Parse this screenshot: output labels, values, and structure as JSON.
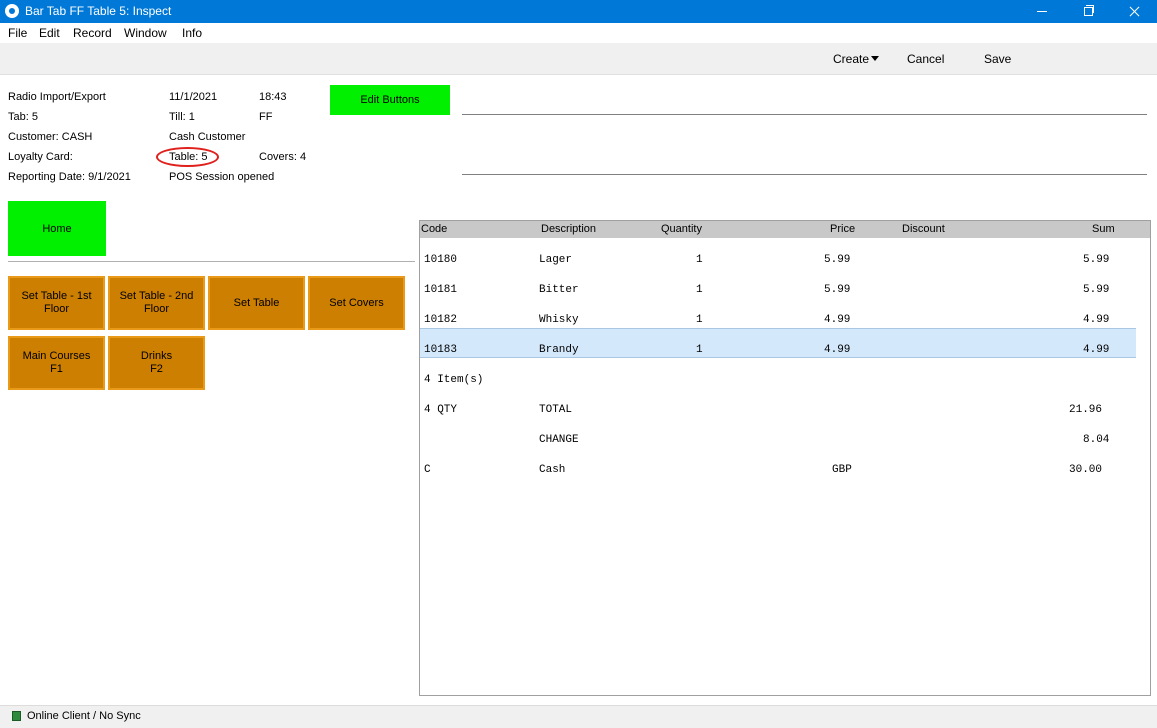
{
  "window": {
    "title": "Bar Tab FF Table 5: Inspect"
  },
  "menu": [
    "File",
    "Edit",
    "Record",
    "Window",
    "Info"
  ],
  "toolbar": {
    "create_label": "Create",
    "cancel_label": "Cancel",
    "save_label": "Save"
  },
  "info": {
    "radio_import_export": "Radio Import/Export",
    "date": "11/1/2021",
    "time": "18:43",
    "tab": "Tab: 5",
    "till": "Till: 1",
    "ff": "FF",
    "customer": "Customer: CASH",
    "customer_name": "Cash Customer",
    "loyalty_card": "Loyalty Card:",
    "table": "Table: 5",
    "covers": "Covers: 4",
    "reporting_date": "Reporting Date: 9/1/2021",
    "session_status": "POS Session opened"
  },
  "buttons": {
    "edit_buttons": "Edit Buttons",
    "home": "Home",
    "set_table_1st": "Set Table - 1st\nFloor",
    "set_table_2nd": "Set Table - 2nd\nFloor",
    "set_table": "Set Table",
    "set_covers": "Set Covers",
    "main_courses": "Main Courses\nF1",
    "drinks": "Drinks\nF2"
  },
  "grid": {
    "headers": {
      "code": "Code",
      "description": "Description",
      "quantity": "Quantity",
      "price": "Price",
      "discount": "Discount",
      "sum": "Sum"
    },
    "rows": [
      {
        "code": "10180",
        "description": "Lager",
        "quantity": "1",
        "price": "5.99",
        "sum": "5.99"
      },
      {
        "code": "10181",
        "description": "Bitter",
        "quantity": "1",
        "price": "5.99",
        "sum": "5.99"
      },
      {
        "code": "10182",
        "description": "Whisky",
        "quantity": "1",
        "price": "4.99",
        "sum": "4.99"
      },
      {
        "code": "10183",
        "description": "Brandy",
        "quantity": "1",
        "price": "4.99",
        "sum": "4.99"
      }
    ],
    "items_count": "4 Item(s)",
    "total_qty": "4 QTY",
    "total_label": "TOTAL",
    "total_value": "21.96",
    "change_label": "CHANGE",
    "change_value": "8.04",
    "payment_code": "C",
    "payment_method": "Cash",
    "payment_currency": "GBP",
    "payment_value": "30.00"
  },
  "status": {
    "text": "Online Client / No Sync",
    "indicator_color": "#2e8b3e"
  }
}
